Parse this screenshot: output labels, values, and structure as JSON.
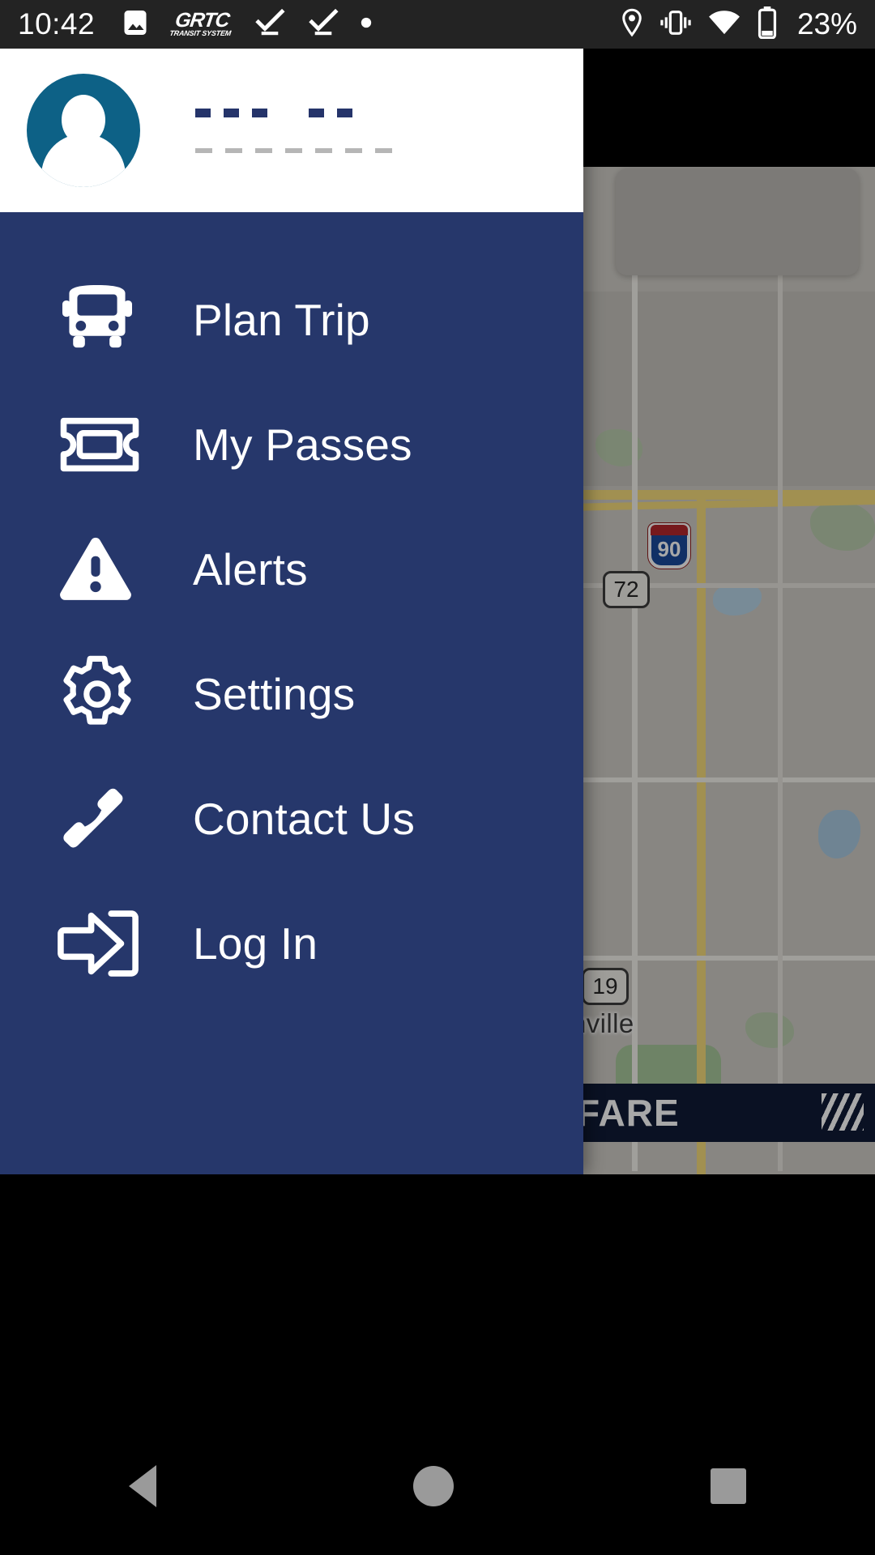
{
  "status_bar": {
    "time": "10:42",
    "battery_percent": "23%",
    "brand_logo_line1": "GRTC",
    "brand_logo_line2": "TRANSIT SYSTEM",
    "left_icons": [
      "image-icon",
      "grtc-app-icon",
      "task-complete-icon",
      "task-complete-icon",
      "dot-notification-icon"
    ],
    "right_icons": [
      "location-icon",
      "vibrate-icon",
      "wifi-icon",
      "battery-icon"
    ]
  },
  "drawer": {
    "background_color": "#26376b",
    "profile": {
      "avatar_icon": "person-avatar-icon",
      "avatar_color": "#0d6186",
      "name_placeholder": "- - - -  - -",
      "detail_placeholder": "- - - - - - - -"
    },
    "menu_items": [
      {
        "id": "plan-trip",
        "label": "Plan Trip",
        "icon": "bus-icon"
      },
      {
        "id": "my-passes",
        "label": "My Passes",
        "icon": "ticket-icon"
      },
      {
        "id": "alerts",
        "label": "Alerts",
        "icon": "warning-triangle-icon"
      },
      {
        "id": "settings",
        "label": "Settings",
        "icon": "gear-icon"
      },
      {
        "id": "contact-us",
        "label": "Contact Us",
        "icon": "phone-icon"
      },
      {
        "id": "log-in",
        "label": "Log In",
        "icon": "login-arrow-icon"
      }
    ]
  },
  "map": {
    "interstate_shield": "90",
    "route_shield_1": "72",
    "route_shield_2": "19",
    "place_label": "nville",
    "fare_badge_text": "FARE"
  },
  "nav_bar": {
    "back_label": "back-triangle-icon",
    "home_label": "home-circle-icon",
    "recents_label": "recents-square-icon"
  }
}
